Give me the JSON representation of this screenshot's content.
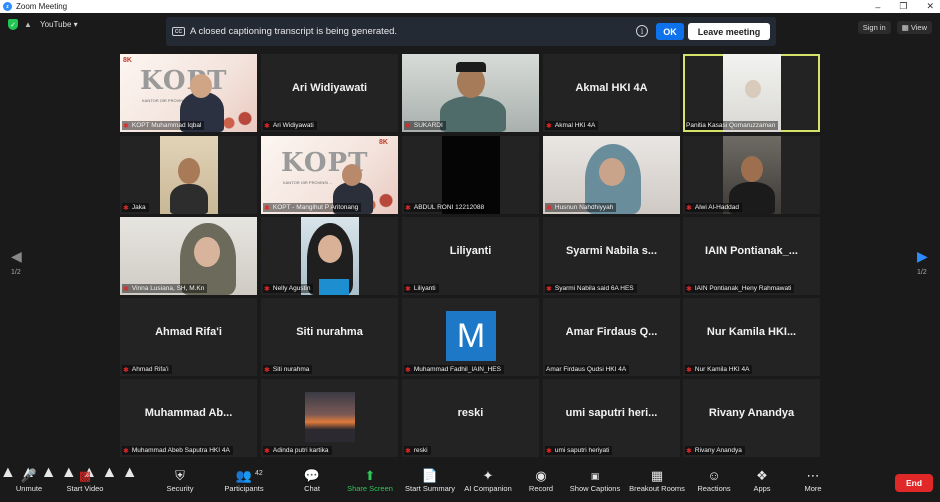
{
  "window": {
    "title": "Zoom Meeting"
  },
  "topbar": {
    "youtube_label": "YouTube ▾",
    "sign_in": "Sign in",
    "view": "View"
  },
  "banner": {
    "message": "A closed captioning transcript is being generated.",
    "ok_label": "OK",
    "leave_label": "Leave meeting",
    "cc_label": "CC",
    "info_label": "i"
  },
  "nav": {
    "prev_page": "1/2",
    "next_page": "1/2"
  },
  "tiles": [
    {
      "label": "KOPT Muhammad Iqbal",
      "center": ""
    },
    {
      "label": "Ari Widiyawati",
      "center": "Ari Widiyawati"
    },
    {
      "label": "SUKARDI",
      "center": ""
    },
    {
      "label": "Akmal HKI 4A",
      "center": "Akmal HKI 4A"
    },
    {
      "label": "Panitia Kasasi Qomaruzzaman",
      "center": ""
    },
    {
      "label": "Jaka",
      "center": ""
    },
    {
      "label": "KOPT - Mangihut P Aritonang",
      "center": ""
    },
    {
      "label": "ABDUL RONI 12212088",
      "center": ""
    },
    {
      "label": "Husnun Nahdhiyyah",
      "center": ""
    },
    {
      "label": "Alwi Al-Haddad",
      "center": ""
    },
    {
      "label": "Vinna Lusiana, SH, M.Kn",
      "center": ""
    },
    {
      "label": "Nelly Agustin",
      "center": ""
    },
    {
      "label": "Liliyanti",
      "center": "Liliyanti"
    },
    {
      "label": "Syarmi Nabila said 6A HES",
      "center": "Syarmi Nabila s..."
    },
    {
      "label": "IAIN Pontianak_Heny Rahmawati",
      "center": "IAIN Pontianak_..."
    },
    {
      "label": "Ahmad Rifa'i",
      "center": "Ahmad Rifa'i"
    },
    {
      "label": "Siti nurahma",
      "center": "Siti nurahma"
    },
    {
      "label": "Muhammad Fadhil_IAIN_HES",
      "center": ""
    },
    {
      "label": "Amar Firdaus Qudsi HKI 4A",
      "center": "Amar Firdaus Q..."
    },
    {
      "label": "Nur Kamila HKI 4A",
      "center": "Nur Kamila HKI..."
    },
    {
      "label": "Muhammad Abeb Saputra HKI 4A",
      "center": "Muhammad Ab..."
    },
    {
      "label": "Adinda putri kartika",
      "center": ""
    },
    {
      "label": "reski",
      "center": "reski"
    },
    {
      "label": "umi saputri heriyati",
      "center": "umi saputri heri..."
    },
    {
      "label": "Rivany Anandya",
      "center": "Rivany Anandya"
    }
  ],
  "brand": {
    "kopt": "KOPT",
    "sub": "KANTOR OIR PROVINSI ...",
    "logo": "8K"
  },
  "avatar_letter": "M",
  "toolbar": {
    "unmute": "Unmute",
    "start_video": "Start Video",
    "security": "Security",
    "participants": "Participants",
    "participants_count": "42",
    "chat": "Chat",
    "share_screen": "Share Screen",
    "start_summary": "Start Summary",
    "ai_companion": "AI Companion",
    "record": "Record",
    "show_captions": "Show Captions",
    "breakout_rooms": "Breakout Rooms",
    "reactions": "Reactions",
    "apps": "Apps",
    "more": "More",
    "end": "End"
  },
  "colors": {
    "accent": "#0e72ed",
    "end": "#e02828",
    "share": "#2fc659",
    "active_speaker": "#d6e26a"
  }
}
